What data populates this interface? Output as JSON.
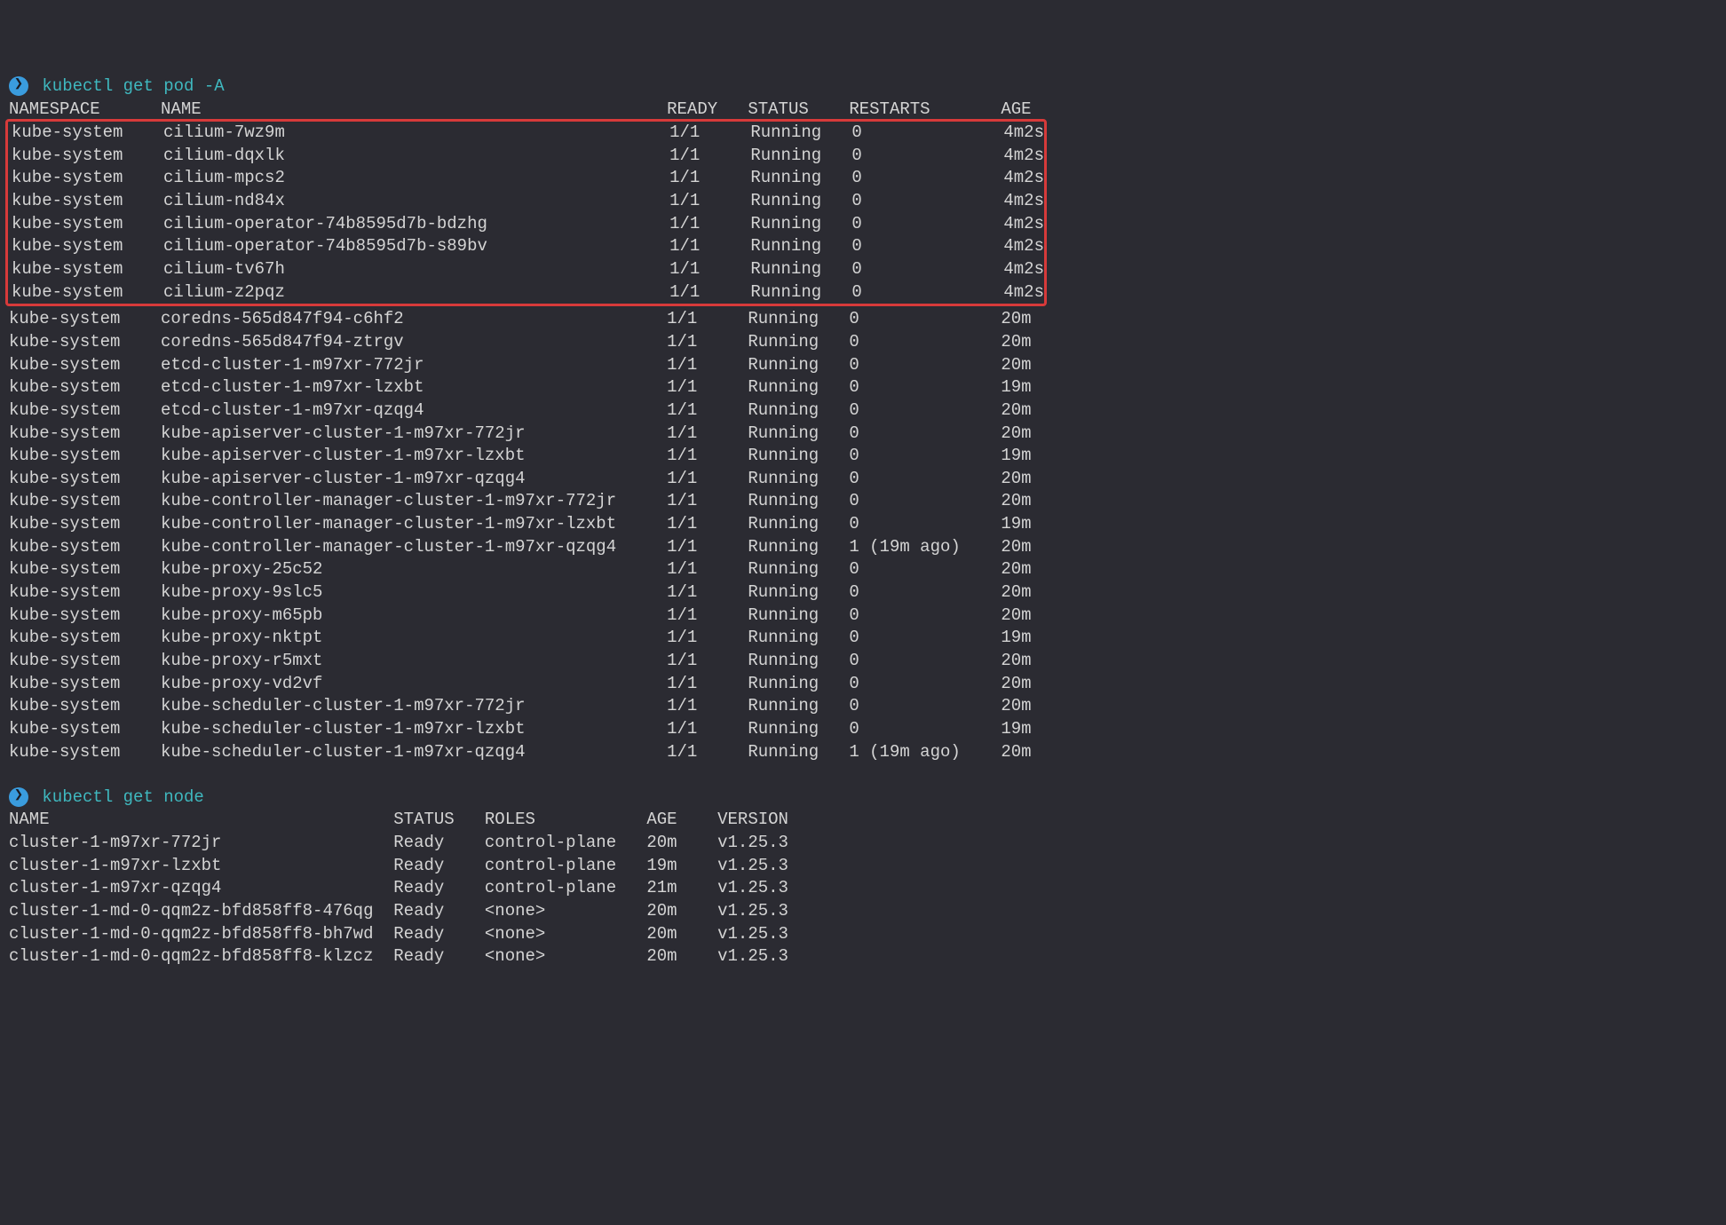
{
  "prompt_marker": "❯",
  "cmd1": "kubectl get pod -A",
  "pods_header": {
    "namespace": "NAMESPACE",
    "name": "NAME",
    "ready": "READY",
    "status": "STATUS",
    "restarts": "RESTARTS",
    "age": "AGE"
  },
  "highlighted_pods": [
    {
      "namespace": "kube-system",
      "name": "cilium-7wz9m",
      "ready": "1/1",
      "status": "Running",
      "restarts": "0",
      "age": "4m2s"
    },
    {
      "namespace": "kube-system",
      "name": "cilium-dqxlk",
      "ready": "1/1",
      "status": "Running",
      "restarts": "0",
      "age": "4m2s"
    },
    {
      "namespace": "kube-system",
      "name": "cilium-mpcs2",
      "ready": "1/1",
      "status": "Running",
      "restarts": "0",
      "age": "4m2s"
    },
    {
      "namespace": "kube-system",
      "name": "cilium-nd84x",
      "ready": "1/1",
      "status": "Running",
      "restarts": "0",
      "age": "4m2s"
    },
    {
      "namespace": "kube-system",
      "name": "cilium-operator-74b8595d7b-bdzhg",
      "ready": "1/1",
      "status": "Running",
      "restarts": "0",
      "age": "4m2s"
    },
    {
      "namespace": "kube-system",
      "name": "cilium-operator-74b8595d7b-s89bv",
      "ready": "1/1",
      "status": "Running",
      "restarts": "0",
      "age": "4m2s"
    },
    {
      "namespace": "kube-system",
      "name": "cilium-tv67h",
      "ready": "1/1",
      "status": "Running",
      "restarts": "0",
      "age": "4m2s"
    },
    {
      "namespace": "kube-system",
      "name": "cilium-z2pqz",
      "ready": "1/1",
      "status": "Running",
      "restarts": "0",
      "age": "4m2s"
    }
  ],
  "pods": [
    {
      "namespace": "kube-system",
      "name": "coredns-565d847f94-c6hf2",
      "ready": "1/1",
      "status": "Running",
      "restarts": "0",
      "age": "20m"
    },
    {
      "namespace": "kube-system",
      "name": "coredns-565d847f94-ztrgv",
      "ready": "1/1",
      "status": "Running",
      "restarts": "0",
      "age": "20m"
    },
    {
      "namespace": "kube-system",
      "name": "etcd-cluster-1-m97xr-772jr",
      "ready": "1/1",
      "status": "Running",
      "restarts": "0",
      "age": "20m"
    },
    {
      "namespace": "kube-system",
      "name": "etcd-cluster-1-m97xr-lzxbt",
      "ready": "1/1",
      "status": "Running",
      "restarts": "0",
      "age": "19m"
    },
    {
      "namespace": "kube-system",
      "name": "etcd-cluster-1-m97xr-qzqg4",
      "ready": "1/1",
      "status": "Running",
      "restarts": "0",
      "age": "20m"
    },
    {
      "namespace": "kube-system",
      "name": "kube-apiserver-cluster-1-m97xr-772jr",
      "ready": "1/1",
      "status": "Running",
      "restarts": "0",
      "age": "20m"
    },
    {
      "namespace": "kube-system",
      "name": "kube-apiserver-cluster-1-m97xr-lzxbt",
      "ready": "1/1",
      "status": "Running",
      "restarts": "0",
      "age": "19m"
    },
    {
      "namespace": "kube-system",
      "name": "kube-apiserver-cluster-1-m97xr-qzqg4",
      "ready": "1/1",
      "status": "Running",
      "restarts": "0",
      "age": "20m"
    },
    {
      "namespace": "kube-system",
      "name": "kube-controller-manager-cluster-1-m97xr-772jr",
      "ready": "1/1",
      "status": "Running",
      "restarts": "0",
      "age": "20m"
    },
    {
      "namespace": "kube-system",
      "name": "kube-controller-manager-cluster-1-m97xr-lzxbt",
      "ready": "1/1",
      "status": "Running",
      "restarts": "0",
      "age": "19m"
    },
    {
      "namespace": "kube-system",
      "name": "kube-controller-manager-cluster-1-m97xr-qzqg4",
      "ready": "1/1",
      "status": "Running",
      "restarts": "1 (19m ago)",
      "age": "20m"
    },
    {
      "namespace": "kube-system",
      "name": "kube-proxy-25c52",
      "ready": "1/1",
      "status": "Running",
      "restarts": "0",
      "age": "20m"
    },
    {
      "namespace": "kube-system",
      "name": "kube-proxy-9slc5",
      "ready": "1/1",
      "status": "Running",
      "restarts": "0",
      "age": "20m"
    },
    {
      "namespace": "kube-system",
      "name": "kube-proxy-m65pb",
      "ready": "1/1",
      "status": "Running",
      "restarts": "0",
      "age": "20m"
    },
    {
      "namespace": "kube-system",
      "name": "kube-proxy-nktpt",
      "ready": "1/1",
      "status": "Running",
      "restarts": "0",
      "age": "19m"
    },
    {
      "namespace": "kube-system",
      "name": "kube-proxy-r5mxt",
      "ready": "1/1",
      "status": "Running",
      "restarts": "0",
      "age": "20m"
    },
    {
      "namespace": "kube-system",
      "name": "kube-proxy-vd2vf",
      "ready": "1/1",
      "status": "Running",
      "restarts": "0",
      "age": "20m"
    },
    {
      "namespace": "kube-system",
      "name": "kube-scheduler-cluster-1-m97xr-772jr",
      "ready": "1/1",
      "status": "Running",
      "restarts": "0",
      "age": "20m"
    },
    {
      "namespace": "kube-system",
      "name": "kube-scheduler-cluster-1-m97xr-lzxbt",
      "ready": "1/1",
      "status": "Running",
      "restarts": "0",
      "age": "19m"
    },
    {
      "namespace": "kube-system",
      "name": "kube-scheduler-cluster-1-m97xr-qzqg4",
      "ready": "1/1",
      "status": "Running",
      "restarts": "1 (19m ago)",
      "age": "20m"
    }
  ],
  "cmd2": "kubectl get node",
  "nodes_header": {
    "name": "NAME",
    "status": "STATUS",
    "roles": "ROLES",
    "age": "AGE",
    "version": "VERSION"
  },
  "nodes": [
    {
      "name": "cluster-1-m97xr-772jr",
      "status": "Ready",
      "roles": "control-plane",
      "age": "20m",
      "version": "v1.25.3"
    },
    {
      "name": "cluster-1-m97xr-lzxbt",
      "status": "Ready",
      "roles": "control-plane",
      "age": "19m",
      "version": "v1.25.3"
    },
    {
      "name": "cluster-1-m97xr-qzqg4",
      "status": "Ready",
      "roles": "control-plane",
      "age": "21m",
      "version": "v1.25.3"
    },
    {
      "name": "cluster-1-md-0-qqm2z-bfd858ff8-476qg",
      "status": "Ready",
      "roles": "<none>",
      "age": "20m",
      "version": "v1.25.3"
    },
    {
      "name": "cluster-1-md-0-qqm2z-bfd858ff8-bh7wd",
      "status": "Ready",
      "roles": "<none>",
      "age": "20m",
      "version": "v1.25.3"
    },
    {
      "name": "cluster-1-md-0-qqm2z-bfd858ff8-klzcz",
      "status": "Ready",
      "roles": "<none>",
      "age": "20m",
      "version": "v1.25.3"
    }
  ],
  "col_widths": {
    "pods": {
      "namespace": 15,
      "name": 50,
      "ready": 8,
      "status": 10,
      "restarts": 15,
      "age": 6
    },
    "nodes": {
      "name": 38,
      "status": 9,
      "roles": 16,
      "age": 7,
      "version": 10
    }
  }
}
